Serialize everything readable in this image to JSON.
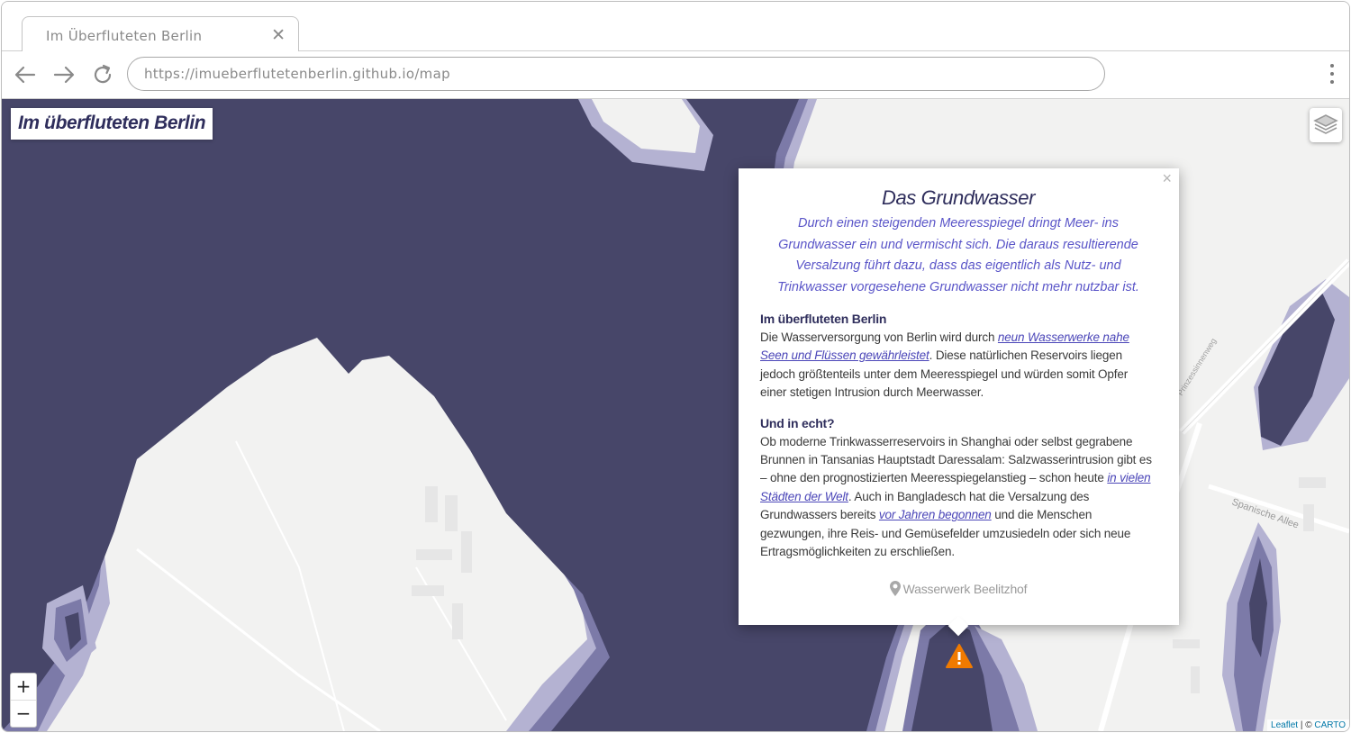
{
  "browser": {
    "tab_title": "Im Überfluteten Berlin",
    "url": "https://imueberflutetenberlin.github.io/map"
  },
  "map": {
    "title": "Im überfluteten Berlin",
    "zoom_in": "+",
    "zoom_out": "−",
    "attribution_leaflet": "Leaflet",
    "attribution_sep": " | © ",
    "attribution_carto": "CARTO",
    "street_labels": [
      "Spanische Allee",
      "Prinzessinnenweg"
    ],
    "colors": {
      "water": "#474669",
      "flood_mid": "#7c7aa8",
      "flood_light": "#b4b2d2",
      "land": "#f2f2f1",
      "marker": "#f07a00"
    }
  },
  "popup": {
    "close": "×",
    "title": "Das Grundwasser",
    "intro": "Durch einen steigenden Meeresspiegel dringt Meer- ins Grundwasser ein und vermischt sich. Die daraus resultierende Versalzung führt dazu, dass das eigentlich als Nutz- und Trinkwasser vorgesehene Grundwasser nicht mehr nutzbar ist.",
    "section1": {
      "heading": "Im überfluteten Berlin",
      "text_a": "Die Wasserversorgung von Berlin wird durch ",
      "link_a": "neun Wasserwerke nahe Seen und Flüssen gewährleistet",
      "text_b": ". Diese natürlichen Reservoirs liegen jedoch größtenteils unter dem Meeresspiegel und würden somit Opfer einer stetigen Intrusion durch Meerwasser."
    },
    "section2": {
      "heading": "Und in echt?",
      "text_a": "Ob moderne Trinkwasserreservoirs in Shanghai oder selbst gegrabene Brunnen in Tansanias Hauptstadt Daressalam: Salzwasserintrusion gibt es – ohne den prognostizierten Meeresspiegelanstieg – schon heute ",
      "link_a": "in vielen Städten der Welt",
      "text_b": ". Auch in Bangladesch hat die Versalzung des Grundwassers bereits ",
      "link_b": "vor Jahren begonnen",
      "text_c": " und die Menschen gezwungen, ihre Reis- und Gemüsefelder umzusiedeln oder sich neue Ertragsmöglichkeiten zu erschließen."
    },
    "location": "Wasserwerk Beelitzhof"
  }
}
